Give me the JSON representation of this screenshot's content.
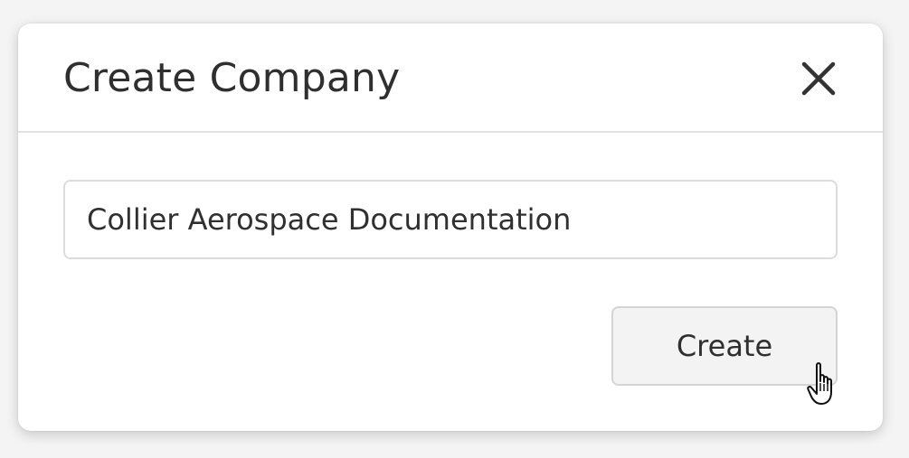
{
  "dialog": {
    "title": "Create Company",
    "close_icon": "close-icon",
    "company_name_value": "Collier Aerospace Documentation",
    "create_label": "Create"
  },
  "cursor": {
    "icon": "hand-pointer-icon"
  }
}
